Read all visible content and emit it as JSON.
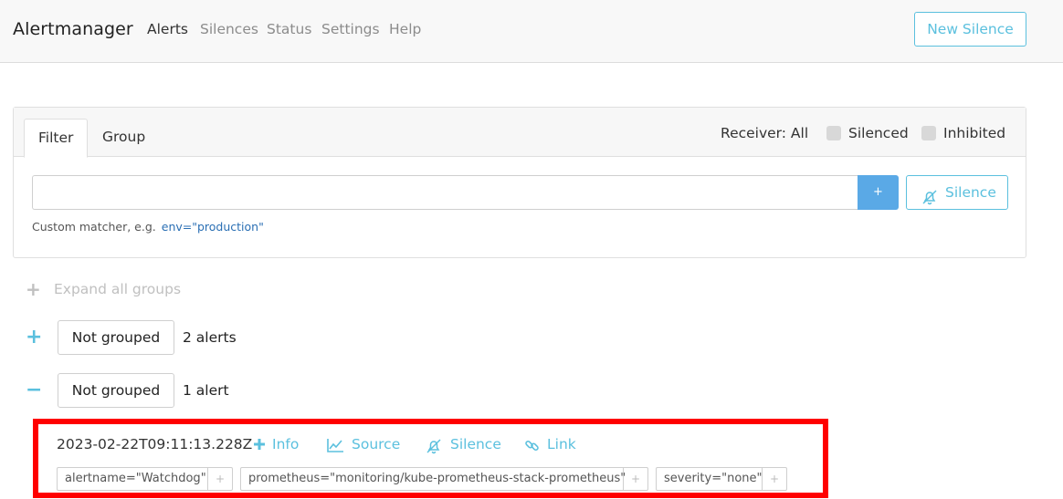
{
  "navbar": {
    "brand": "Alertmanager",
    "links": [
      "Alerts",
      "Silences",
      "Status",
      "Settings",
      "Help"
    ],
    "new_silence_label": "New Silence"
  },
  "filter_card": {
    "tabs": [
      "Filter",
      "Group"
    ],
    "receiver_label": "Receiver: All",
    "silenced_label": "Silenced",
    "inhibited_label": "Inhibited",
    "input_value": "",
    "plus_label": "+",
    "silence_button_label": "Silence",
    "hint_text": "Custom matcher, e.g.",
    "hint_example": "env=\"production\""
  },
  "groups": {
    "expand_all_label": "Expand all groups",
    "list": [
      {
        "toggle": "+",
        "name": "Not grouped",
        "count": "2 alerts"
      },
      {
        "toggle": "−",
        "name": "Not grouped",
        "count": "1 alert"
      }
    ]
  },
  "alert": {
    "timestamp": "2023-02-22T09:11:13.228Z",
    "actions": [
      "Info",
      "Source",
      "Silence",
      "Link"
    ],
    "labels": [
      "alertname=\"Watchdog\"",
      "prometheus=\"monitoring/kube-prometheus-stack-prometheus\"",
      "severity=\"none\""
    ],
    "label_add": "+"
  },
  "colors": {
    "accent": "#5bc0de",
    "primary_button": "#5aa9e6",
    "highlight_border": "#ff0000"
  }
}
